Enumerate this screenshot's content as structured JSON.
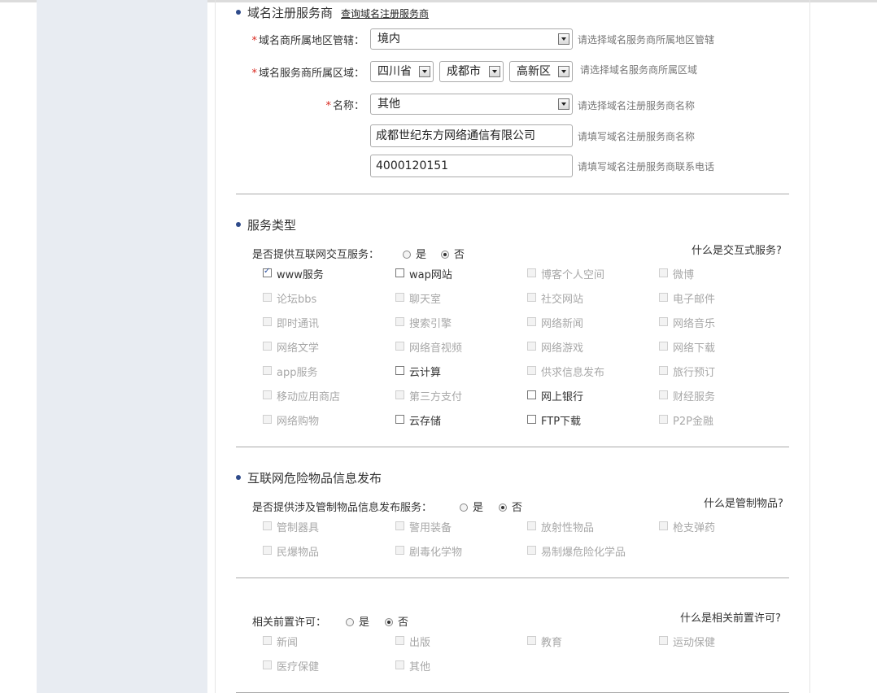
{
  "domain_registrar": {
    "title": "域名注册服务商",
    "query_link": "查询域名注册服务商",
    "region_label": "域名商所属地区管辖：",
    "region_value": "境内",
    "region_hint": "请选择域名服务商所属地区管辖",
    "area_label": "域名服务商所属区域：",
    "province": "四川省",
    "city": "成都市",
    "district": "高新区",
    "area_hint": "请选择域名服务商所属区域",
    "name_label": "名称：",
    "name_value": "其他",
    "name_hint": "请选择域名注册服务商名称",
    "company_value": "成都世纪东方网络通信有限公司",
    "company_hint": "请填写域名注册服务商名称",
    "phone_value": "4000120151",
    "phone_hint": "请填写域名注册服务商联系电话"
  },
  "service_type": {
    "title": "服务类型",
    "question": "是否提供互联网交互服务：",
    "yes": "是",
    "no": "否",
    "selected": "否",
    "help": "什么是交互式服务?",
    "items": [
      {
        "label": "www服务",
        "state": "checked"
      },
      {
        "label": "wap网站",
        "state": "enabled"
      },
      {
        "label": "博客个人空间",
        "state": "disabled"
      },
      {
        "label": "微博",
        "state": "disabled"
      },
      {
        "label": "论坛bbs",
        "state": "disabled"
      },
      {
        "label": "聊天室",
        "state": "disabled"
      },
      {
        "label": "社交网站",
        "state": "disabled"
      },
      {
        "label": "电子邮件",
        "state": "disabled"
      },
      {
        "label": "即时通讯",
        "state": "disabled"
      },
      {
        "label": "搜索引擎",
        "state": "disabled"
      },
      {
        "label": "网络新闻",
        "state": "disabled"
      },
      {
        "label": "网络音乐",
        "state": "disabled"
      },
      {
        "label": "网络文学",
        "state": "disabled"
      },
      {
        "label": "网络音视频",
        "state": "disabled"
      },
      {
        "label": "网络游戏",
        "state": "disabled"
      },
      {
        "label": "网络下载",
        "state": "disabled"
      },
      {
        "label": "app服务",
        "state": "disabled"
      },
      {
        "label": "云计算",
        "state": "enabled"
      },
      {
        "label": "供求信息发布",
        "state": "disabled"
      },
      {
        "label": "旅行预订",
        "state": "disabled"
      },
      {
        "label": "移动应用商店",
        "state": "disabled"
      },
      {
        "label": "第三方支付",
        "state": "disabled"
      },
      {
        "label": "网上银行",
        "state": "enabled"
      },
      {
        "label": "财经服务",
        "state": "disabled"
      },
      {
        "label": "网络购物",
        "state": "disabled"
      },
      {
        "label": "云存储",
        "state": "enabled"
      },
      {
        "label": "FTP下载",
        "state": "enabled"
      },
      {
        "label": "P2P金融",
        "state": "disabled"
      }
    ]
  },
  "dangerous_goods": {
    "title": "互联网危险物品信息发布",
    "question": "是否提供涉及管制物品信息发布服务：",
    "yes": "是",
    "no": "否",
    "selected": "否",
    "help": "什么是管制物品?",
    "items": [
      {
        "label": "管制器具",
        "state": "disabled"
      },
      {
        "label": "警用装备",
        "state": "disabled"
      },
      {
        "label": "放射性物品",
        "state": "disabled"
      },
      {
        "label": "枪支弹药",
        "state": "disabled"
      },
      {
        "label": "民爆物品",
        "state": "disabled"
      },
      {
        "label": "剧毒化学物",
        "state": "disabled"
      },
      {
        "label": "易制爆危险化学品",
        "state": "disabled"
      }
    ]
  },
  "permit": {
    "question": "相关前置许可：",
    "yes": "是",
    "no": "否",
    "selected": "否",
    "help": "什么是相关前置许可?",
    "items": [
      {
        "label": "新闻",
        "state": "disabled"
      },
      {
        "label": "出版",
        "state": "disabled"
      },
      {
        "label": "教育",
        "state": "disabled"
      },
      {
        "label": "运动保健",
        "state": "disabled"
      },
      {
        "label": "医疗保健",
        "state": "disabled"
      },
      {
        "label": "其他",
        "state": "disabled"
      }
    ]
  }
}
